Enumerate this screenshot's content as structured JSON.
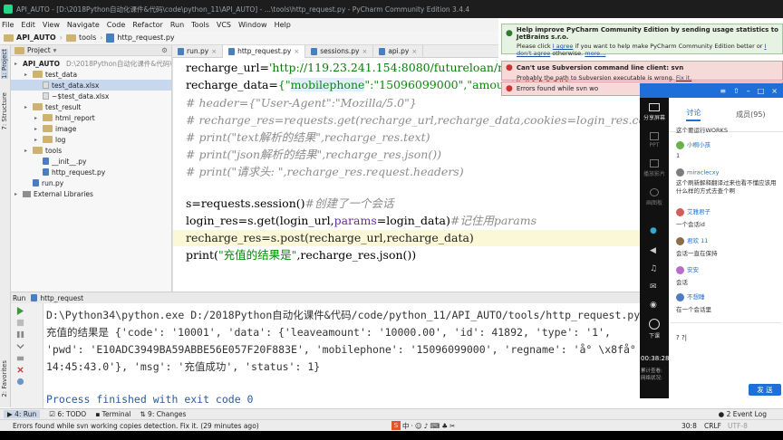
{
  "window": {
    "title": "API_AUTO - [D:\\2018Python自动化课件&代码\\code\\python_11\\API_AUTO] - ...\\tools\\http_request.py - PyCharm Community Edition 3.4.4"
  },
  "menu": [
    "File",
    "Edit",
    "View",
    "Navigate",
    "Code",
    "Refactor",
    "Run",
    "Tools",
    "VCS",
    "Window",
    "Help"
  ],
  "breadcrumb": [
    "API_AUTO",
    "tools",
    "http_request.py"
  ],
  "project_panel": {
    "header": "Project",
    "root": "API_AUTO",
    "root_path": "D:\\2018Python自动化课件&代码\\co",
    "items": [
      {
        "label": "API_AUTO",
        "indent": 0,
        "type": "folder"
      },
      {
        "label": "test_data",
        "indent": 1,
        "type": "folder"
      },
      {
        "label": "test_data.xlsx",
        "indent": 2,
        "type": "xlsx",
        "selected": true
      },
      {
        "label": "~$test_data.xlsx",
        "indent": 2,
        "type": "xlsx"
      },
      {
        "label": "test_result",
        "indent": 1,
        "type": "folder"
      },
      {
        "label": "html_report",
        "indent": 2,
        "type": "folder"
      },
      {
        "label": "image",
        "indent": 2,
        "type": "folder"
      },
      {
        "label": "log",
        "indent": 2,
        "type": "folder"
      },
      {
        "label": "tools",
        "indent": 1,
        "type": "folder"
      },
      {
        "label": "__init__.py",
        "indent": 2,
        "type": "py"
      },
      {
        "label": "http_request.py",
        "indent": 2,
        "type": "py"
      },
      {
        "label": "run.py",
        "indent": 1,
        "type": "py"
      },
      {
        "label": "External Libraries",
        "indent": 0,
        "type": "lib"
      }
    ]
  },
  "left_strip": {
    "project": "1: Project",
    "structure": "7: Structure",
    "favorites": "2: Favorites"
  },
  "editor_tabs": [
    {
      "label": "run.py",
      "active": false
    },
    {
      "label": "http_request.py",
      "active": true
    },
    {
      "label": "sessions.py",
      "active": false
    },
    {
      "label": "api.py",
      "active": false
    }
  ],
  "code": {
    "l1_var": "recharge_url=",
    "l1_str": "'http://119.23.241.154:8080/futureloan/mvc/ap",
    "l2_var": "recharge_data=",
    "l2_a": "{\"",
    "l2_key1": "mobilephone",
    "l2_b": "\":\"15096099000\",\"amount\":\"1000\"}",
    "l3": "# header={\"User-Agent\":\"Mozilla/5.0\"}",
    "l4": "# recharge_res=requests.get(recharge_url,recharge_data,cookies=login_res.cookies)",
    "l5": "# print(\"text解析的结果\",recharge_res.text)",
    "l6": "# print(\"json解析的结果\",recharge_res.json())",
    "l7": "# print(\"请求头: \",recharge_res.request.headers)",
    "l8_code": "s=requests.session()",
    "l8_cmt": "#创建了一个会话",
    "l9_code_a": "login_res=s.get(login_url,",
    "l9_param": "params",
    "l9_code_b": "=login_data)",
    "l9_cmt": "#记住用params",
    "l10": "recharge_res=s.post(recharge_url,recharge_data)",
    "l11_a": "print(",
    "l11_str": "\"充值的结果是\"",
    "l11_b": ",recharge_res.json())"
  },
  "run_panel": {
    "title": "Run",
    "config": "http_request",
    "lines": [
      "D:\\Python34\\python.exe D:/2018Python自动化课件&代码/code/python_11/API_AUTO/tools/http_request.py",
      "充值的结果是 {'code': '10001', 'data': {'leaveamount': '10000.00', 'id': 41892, 'type': '1',",
      " 'pwd': 'E10ADC3949BA59ABBE56E057F20F883E', 'mobilephone': '15096099000', 'regname': 'å° \\x8få° \\x8f', 'r",
      "14:45:43.0'}, 'msg': '充值成功', 'status': 1}",
      "",
      "Process finished with exit code 0"
    ]
  },
  "tool_windows": {
    "run": "4: Run",
    "todo": "6: TODO",
    "changes": "9: Changes",
    "terminal": "Terminal",
    "event_log": "2 Event Log"
  },
  "status": {
    "message": "Errors found while svn working copies detection. Fix it. (29 minutes ago)",
    "position": "30:8",
    "line_sep": "CRLF",
    "encoding": "UTF-8"
  },
  "notifications": [
    {
      "title": "Help improve PyCharm Community Edition by sending usage statistics to JetBrains s.r.o.",
      "body_a": "Please click ",
      "link1": "I agree",
      "body_b": " if you want to help make PyCharm Community Edition better or ",
      "link2": "I don't agree",
      "body_c": " otherwise. ",
      "link3": "more..."
    },
    {
      "title": "Can't use Subversion command line client: svn",
      "body": "Probably the path to Subversion executable is wrong. ",
      "link": "Fix it."
    },
    {
      "title": "Errors found while svn wo"
    }
  ],
  "chat": {
    "tabs": [
      "讨论",
      "成员(95)"
    ],
    "left_labels": [
      "分享屏幕",
      "PPT",
      "播放影片",
      "画图板"
    ],
    "timer": "00:38:28",
    "stats_a": "累计查看:",
    "stats_b": "网络状况:",
    "hangup": "下课",
    "messages": [
      {
        "user": "",
        "text": "这个要运行WORKS"
      },
      {
        "user": "小桐小孩",
        "text": "1"
      },
      {
        "user": "miraclecxy",
        "text": "这个刷新解释翻译过来也看不懂应该用什么样的方式去查个啊"
      },
      {
        "user": "艾雅君子",
        "text": "一个会话id"
      },
      {
        "user": "君欢 11",
        "text": "会话一直在保持"
      },
      {
        "user": "安安",
        "text": "会话"
      },
      {
        "user": "不想睡",
        "text": "在一个会话里"
      }
    ],
    "input": "? ?|",
    "send": "发 送"
  }
}
